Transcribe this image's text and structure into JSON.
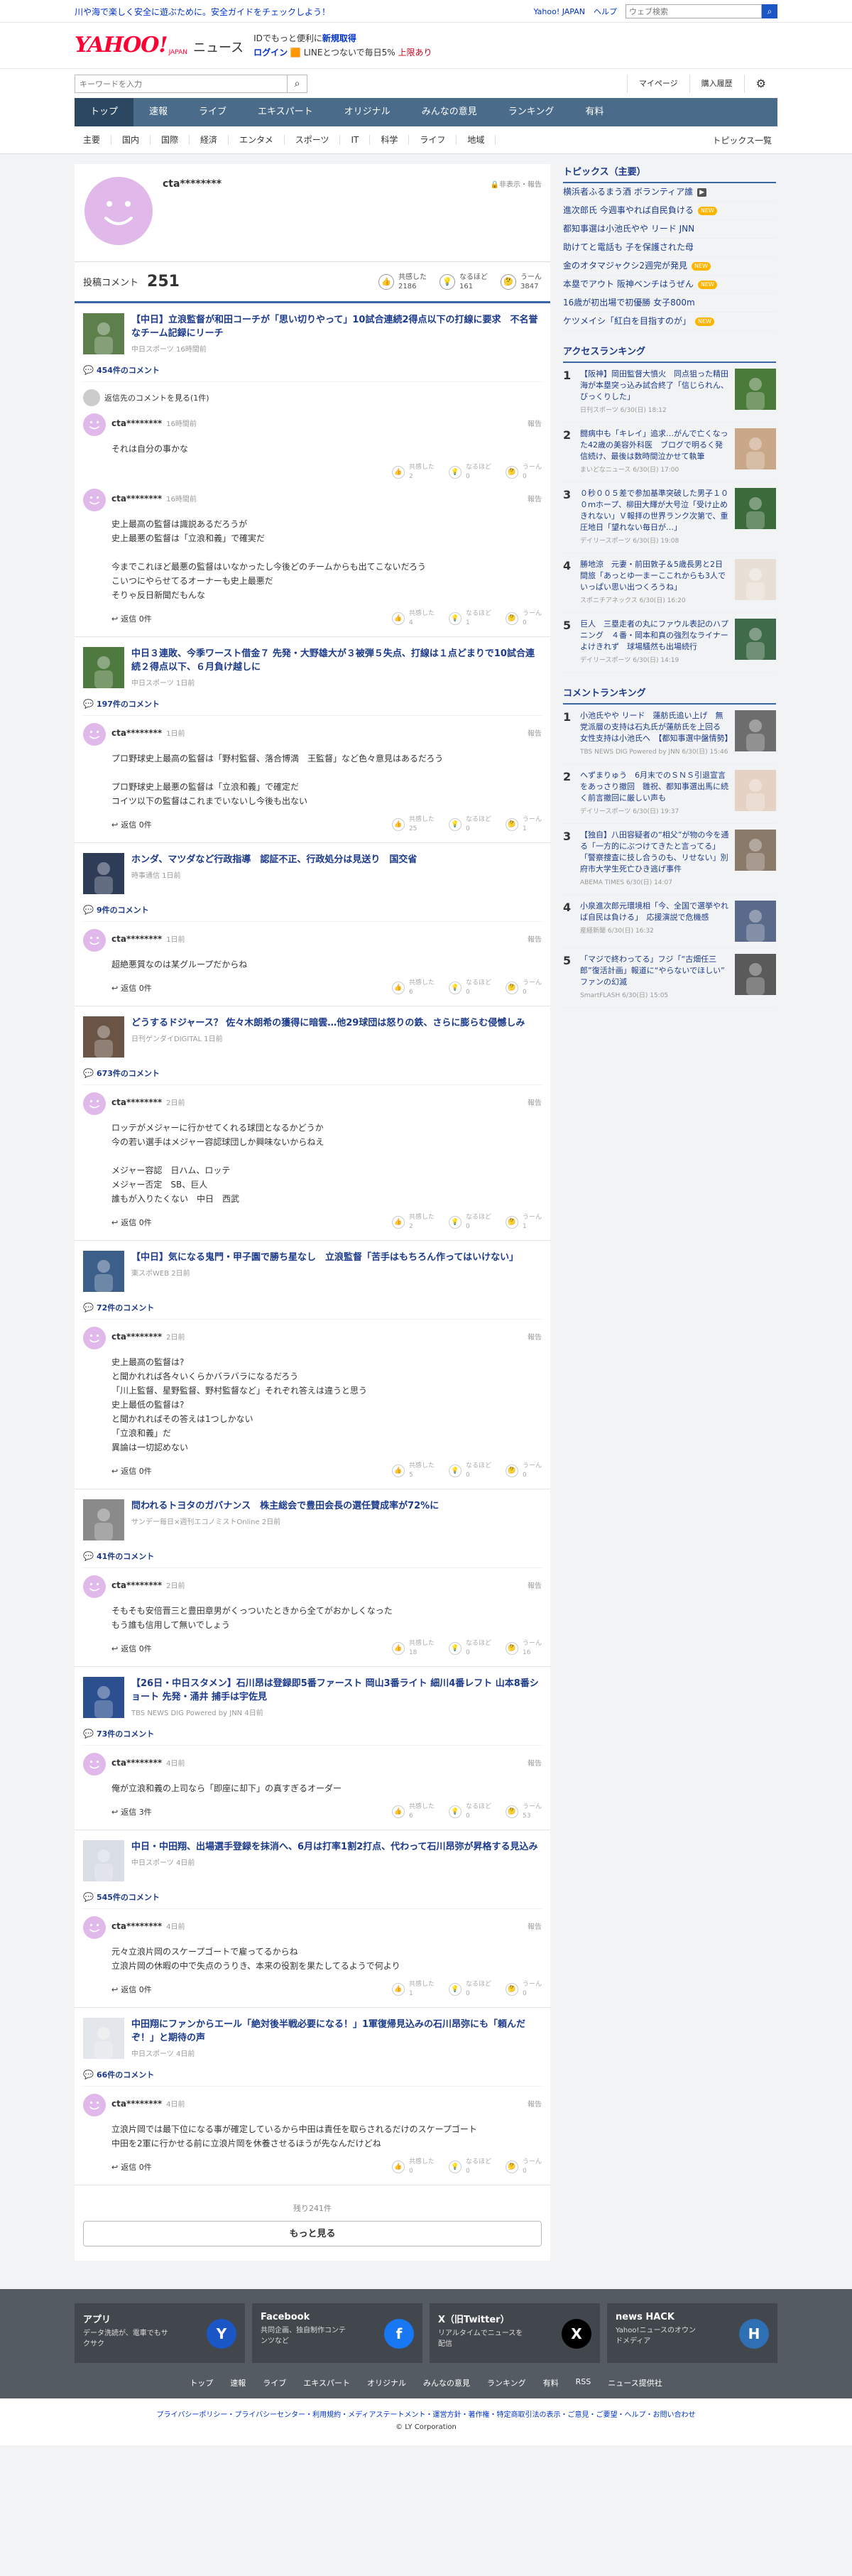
{
  "top": {
    "message": "川や海で楽しく安全に遊ぶために。安全ガイドをチェックしよう！",
    "links": [
      "Yahoo! JAPAN",
      "ヘルプ"
    ],
    "search_placeholder": "ウェブ検索"
  },
  "masthead": {
    "logo": "YAHOO!",
    "logo_sub": "JAPAN",
    "service": "ニュース",
    "promo1_pre": "IDでもっと便利に",
    "promo1_link": "新規取得",
    "promo2_login": "ログイン",
    "promo2_rest": "LINEとつないで毎日5%",
    "promo2_red": "上限あり"
  },
  "searchbar": {
    "placeholder": "キーワードを入力",
    "links": [
      "マイページ",
      "購入履歴"
    ]
  },
  "gnav": [
    "トップ",
    "速報",
    "ライブ",
    "エキスパート",
    "オリジナル",
    "みんなの意見",
    "ランキング",
    "有料"
  ],
  "cats": [
    "主要",
    "国内",
    "国際",
    "経済",
    "エンタメ",
    "スポーツ",
    "IT",
    "科学",
    "ライフ",
    "地域"
  ],
  "cats_all": "トピックス一覧",
  "profile": {
    "name": "cta********",
    "meta": "非表示・報告",
    "label": "投稿コメント",
    "count": "251",
    "reacts": [
      {
        "icon": "👍",
        "label": "共感した",
        "value": "2186"
      },
      {
        "icon": "💡",
        "label": "なるほど",
        "value": "161"
      },
      {
        "icon": "🤔",
        "label": "うーん",
        "value": "3847"
      }
    ]
  },
  "articles": [
    {
      "title": "【中日】立浪監督が和田コーチが「思い切りやって」10試合連続2得点以下の打線に要求　不名誉なチーム記録にリーチ",
      "source": "中日スポーツ",
      "time": "16時間前",
      "ccount": "454件のコメント",
      "reply_link": "返信先のコメントを見る(1件)",
      "comments": [
        {
          "name": "cta********",
          "time": "16時間前",
          "text": "それは自分の事かな",
          "replies": "",
          "r": [
            "2",
            "0",
            "0"
          ]
        },
        {
          "name": "cta********",
          "time": "16時間前",
          "text": "史上最高の監督は識説あるだろうが\n史上最悪の監督は「立浪和義」で確実だ\n\n今までこれほど最悪の監督はいなかったし今後どのチームからも出てこないだろう\nこいつにやらせてるオーナーも史上最悪だ\nそりゃ反日新聞だもんな",
          "replies": "返信 0件",
          "r": [
            "4",
            "1",
            "0"
          ]
        }
      ]
    },
    {
      "title": "中日３連敗、今季ワースト借金７ 先発・大野雄大が３被弾５失点、打線は１点どまりで10試合連続２得点以下、６月負け越しに",
      "source": "中日スポーツ",
      "time": "1日前",
      "ccount": "197件のコメント",
      "reply_link": "",
      "comments": [
        {
          "name": "cta********",
          "time": "1日前",
          "text": "プロ野球史上最高の監督は「野村監督、落合博満　王監督」など色々意見はあるだろう\n\nプロ野球史上最悪の監督は「立浪和義」で確定だ\nコイツ以下の監督はこれまでいないし今後も出ない",
          "replies": "返信 0件",
          "r": [
            "25",
            "0",
            "1"
          ]
        }
      ]
    },
    {
      "title": "ホンダ、マツダなど行政指導　認証不正、行政処分は見送り　国交省",
      "source": "時事通信",
      "time": "1日前",
      "ccount": "9件のコメント",
      "reply_link": "",
      "comments": [
        {
          "name": "cta********",
          "time": "1日前",
          "text": "超絶悪質なのは某グループだからね",
          "replies": "返信 0件",
          "r": [
            "6",
            "0",
            "0"
          ]
        }
      ]
    },
    {
      "title": "どうするドジャース？ 佐々木朗希の獲得に暗雲…他29球団は怒りの鉄、さらに膨らむ侵憾しみ",
      "source": "日刊ゲンダイDIGITAL",
      "time": "1日前",
      "ccount": "673件のコメント",
      "reply_link": "",
      "comments": [
        {
          "name": "cta********",
          "time": "2日前",
          "text": "ロッテがメジャーに行かせてくれる球団となるかどうか\n今の若い選手はメジャー容認球団しか興味ないからねえ\n\nメジャー容認　日ハム、ロッテ\nメジャー否定　SB、巨人\n誰もが入りたくない　中日　西武",
          "replies": "返信 0件",
          "r": [
            "2",
            "0",
            "1"
          ]
        }
      ]
    },
    {
      "title": "【中日】気になる鬼門・甲子園で勝ち星なし　立浪監督「苦手はもちろん作ってはいけない」",
      "source": "東スポWEB",
      "time": "2日前",
      "ccount": "72件のコメント",
      "reply_link": "",
      "comments": [
        {
          "name": "cta********",
          "time": "2日前",
          "text": "史上最高の監督は?\nと聞かれれば各々いくらかバラバラになるだろう\n「川上監督、星野監督、野村監督など」それぞれ答えは違うと思う\n史上最低の監督は?\nと聞かれればその答えは1つしかない\n「立浪和義」だ\n異論は一切認めない",
          "replies": "返信 0件",
          "r": [
            "5",
            "0",
            "0"
          ]
        }
      ]
    },
    {
      "title": "問われるトヨタのガバナンス　株主総会で豊田会長の選任賛成率が72%に",
      "source": "サンデー毎日×週刊エコノミストOnline",
      "time": "2日前",
      "ccount": "41件のコメント",
      "reply_link": "",
      "comments": [
        {
          "name": "cta********",
          "time": "2日前",
          "text": "そもそも安倍晋三と豊田章男がくっついたときから全てがおかしくなった\nもう誰も信用して無いでしょう",
          "replies": "返信 0件",
          "r": [
            "18",
            "0",
            "16"
          ]
        }
      ]
    },
    {
      "title": "【26日・中日スタメン】石川昂は登録即5番ファースト 岡山3番ライト 細川4番レフト 山本8番ショート 先発・涌井 捕手は宇佐見",
      "source": "TBS NEWS DIG Powered by JNN",
      "time": "4日前",
      "ccount": "73件のコメント",
      "reply_link": "",
      "comments": [
        {
          "name": "cta********",
          "time": "4日前",
          "text": "俺が立浪和義の上司なら「即座に却下」の真すぎるオーダー",
          "replies": "返信 3件",
          "r": [
            "6",
            "0",
            "53"
          ]
        }
      ]
    },
    {
      "title": "中日・中田翔、出場選手登録を抹消へ、6月は打率1割2打点、代わって石川昂弥が昇格する見込み",
      "source": "中日スポーツ",
      "time": "4日前",
      "ccount": "545件のコメント",
      "reply_link": "",
      "comments": [
        {
          "name": "cta********",
          "time": "4日前",
          "text": "元々立浪片岡のスケープゴートで雇ってるからね\n立浪片岡の休暇の中で失点のうりき、本来の役割を果たしてるようで何より",
          "replies": "返信 0件",
          "r": [
            "1",
            "0",
            "0"
          ]
        }
      ]
    },
    {
      "title": "中田翔にファンからエール「絶対後半戦必要になる！」1軍復帰見込みの石川昂弥にも「頼んだぞ！」と期待の声",
      "source": "中日スポーツ",
      "time": "4日前",
      "ccount": "66件のコメント",
      "reply_link": "",
      "comments": [
        {
          "name": "cta********",
          "time": "4日前",
          "text": "立浪片岡では最下位になる事が確定しているから中田は責任を取らされるだけのスケープゴート\n中田を2軍に行かせる前に立浪片岡を休養させるほうが先なんだけどね",
          "replies": "返信 0件",
          "r": [
            "0",
            "0",
            "0"
          ]
        }
      ]
    }
  ],
  "more": {
    "remain": "残り241件",
    "button": "もっと見る"
  },
  "side": {
    "topics_title": "トピックス（主要）",
    "topics": [
      {
        "text": "横浜者ふるまう酒 ボランティア誰",
        "badge": "cam"
      },
      {
        "text": "進次郎氏 今週事やれば自民負ける",
        "badge": "new"
      },
      {
        "text": "都知事選は小池氏やや リード JNN",
        "badge": ""
      },
      {
        "text": "助けてと電話も 子を保護された母",
        "badge": ""
      },
      {
        "text": "金のオタマジャクシ2週完が発見",
        "badge": "new"
      },
      {
        "text": "本塁でアウト 阪神ベンチはうぜん",
        "badge": "new"
      },
      {
        "text": "16歳が初出場で初優勝 女子800m",
        "badge": ""
      },
      {
        "text": "ケツメイシ「紅白を目指すのが」",
        "badge": "new"
      }
    ],
    "access_title": "アクセスランキング",
    "access": [
      {
        "rank": "1",
        "text": "【阪神】岡田監督大憤火　同点狙った精田海が本塁突っ込み試合終了「信じられん、びっくりした」",
        "meta": "日刊スポーツ 6/30(日) 18:12"
      },
      {
        "rank": "2",
        "text": "闘病中も「キレイ」追求…がんで亡くなった42歳の美容外科医　ブログで明るく発信続け、最後は数時間泣かせて執筆",
        "meta": "まいどなニュース 6/30(日) 17:00"
      },
      {
        "rank": "3",
        "text": "０秒００５差で参加基準突破した男子１００ｍホープ、柳田大輝が大号泣「受け止めきれない」Ｖ報拝の世界ランク次第で、重圧地日「望れない毎日が…」",
        "meta": "デイリースポーツ 6/30(日) 19:08"
      },
      {
        "rank": "4",
        "text": "勝地涼　元妻・前田敦子＆5歳長男と2日間旅「あっとゆ一まーここれからも3人でいっぱい思い出つくろうね」",
        "meta": "スポニチアネックス 6/30(日) 16:20"
      },
      {
        "rank": "5",
        "text": "巨人　三塁走者の丸にファウル表記のハプニング　４番・岡本和真の強烈なライナーよけきれず　球場騒然も出場続行",
        "meta": "デイリースポーツ 6/30(日) 14:19"
      }
    ],
    "comment_title": "コメントランキング",
    "comment_rank": [
      {
        "rank": "1",
        "text": "小池氏やや リード　蓮舫氏追い上げ　無党派層の支持は石丸氏が蓮舫氏を上回る　女性支持は小池氏へ　【都知事選中盤情勢】",
        "meta": "TBS NEWS DIG Powered by JNN 6/30(日) 15:46"
      },
      {
        "rank": "2",
        "text": "へずまりゅう　6月末でのＳＮＳ引退宣言をあっさり撤回　雛祝、都知事選出馬に続く前言撤回に厳しい声も",
        "meta": "デイリースポーツ 6/30(日) 19:37"
      },
      {
        "rank": "3",
        "text": "【独自】八田容疑者の“相父”が物の今を通る「一方的にぶつけてきたと言ってる」「警察捜査に技し合うのも、リせない」別府市大学生死亡ひき逃げ事件",
        "meta": "ABEMA TIMES 6/30(日) 14:07"
      },
      {
        "rank": "4",
        "text": "小泉進次郎元環境相「今、全国で選挙やれば自民は負ける」　応援演説で危機感",
        "meta": "産経新聞 6/30(日) 16:32"
      },
      {
        "rank": "5",
        "text": "「マジで終わってる」フジ「“古畑任三郎”復活計画」報道に“やらないでほしい” ファンの幻滅",
        "meta": "SmartFLASH 6/30(日) 15:05"
      }
    ]
  },
  "footer": {
    "apps": [
      {
        "title": "アプリ",
        "desc": "データ洗読が、電車でもサクサク",
        "icon": "Y"
      },
      {
        "title": "Facebook",
        "desc": "共同企画、独自制作コンテンツなど",
        "icon": "f"
      },
      {
        "title": "X（旧Twitter）",
        "desc": "リアルタイムでニュースを配信",
        "icon": "X"
      },
      {
        "title": "news HACK",
        "desc": "Yahoo!ニュースのオウンドメディア",
        "icon": "H"
      }
    ],
    "links": [
      "トップ",
      "速報",
      "ライブ",
      "エキスパート",
      "オリジナル",
      "みんなの意見",
      "ランキング",
      "有料",
      "RSS",
      "ニュース提供社"
    ],
    "legal": "プライバシーポリシー・プライバシーセンター・利用規約・メディアステートメント・運営方針・著作権・特定商取引法の表示・ご意見・ご要望・ヘルプ・お問い合わせ",
    "copyright": "© LY Corporation"
  },
  "colors": {
    "accent": "#3b66a6",
    "link": "#1b3a8c",
    "brand": "#ff0033",
    "nav": "#4a6b8a"
  }
}
